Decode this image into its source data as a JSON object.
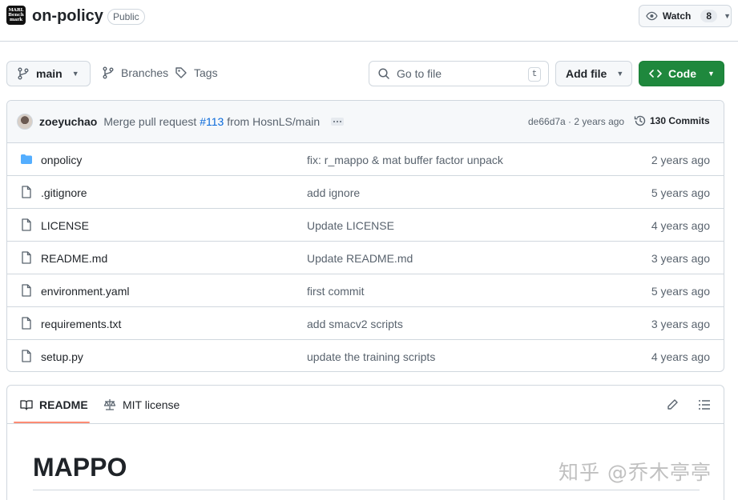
{
  "repo": {
    "avatar_text": "MARL Bench mark",
    "name": "on-policy",
    "visibility": "Public",
    "watch_label": "Watch",
    "watch_count": "8"
  },
  "toolbar": {
    "branch": "main",
    "branches_label": "Branches",
    "tags_label": "Tags",
    "search_placeholder": "Go to file",
    "search_shortcut": "t",
    "add_file_label": "Add file",
    "code_label": "Code"
  },
  "latest_commit": {
    "author": "zoeyuchao",
    "message_prefix": "Merge pull request ",
    "pr": "#113",
    "message_suffix": " from HosnLS/main",
    "meta": "de66d7a · 2 years ago",
    "commits": "130 Commits"
  },
  "files": [
    {
      "name": "onpolicy",
      "type": "dir",
      "message": "fix: r_mappo & mat buffer factor unpack",
      "age": "2 years ago"
    },
    {
      "name": ".gitignore",
      "type": "file",
      "message": "add ignore",
      "age": "5 years ago"
    },
    {
      "name": "LICENSE",
      "type": "file",
      "message": "Update LICENSE",
      "age": "4 years ago"
    },
    {
      "name": "README.md",
      "type": "file",
      "message": "Update README.md",
      "age": "3 years ago"
    },
    {
      "name": "environment.yaml",
      "type": "file",
      "message": "first commit",
      "age": "5 years ago"
    },
    {
      "name": "requirements.txt",
      "type": "file",
      "message": "add smacv2 scripts",
      "age": "3 years ago"
    },
    {
      "name": "setup.py",
      "type": "file",
      "message": "update the training scripts",
      "age": "4 years ago"
    }
  ],
  "readme": {
    "tab_readme": "README",
    "tab_license": "MIT license",
    "heading": "MAPPO"
  },
  "watermark": "知乎 @乔木亭亭",
  "colors": {
    "accent_green": "#1f883d",
    "link_blue": "#0969da",
    "folder_blue": "#54aeff",
    "tab_underline": "#fd8c73"
  }
}
